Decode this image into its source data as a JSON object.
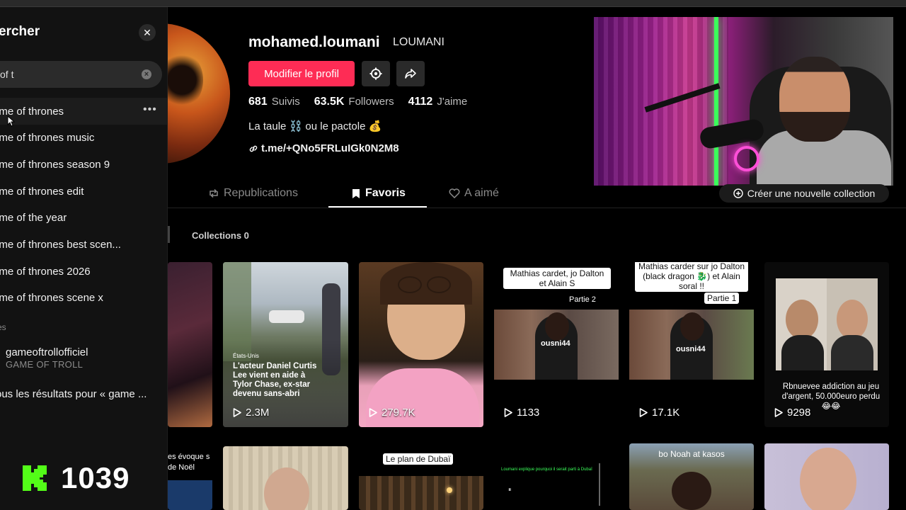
{
  "search": {
    "title": "ercher",
    "query": "of t",
    "suggestions": [
      "ame of thrones",
      "ame of thrones music",
      "ame of thrones season 9",
      "ame of thrones edit",
      "ame of the year",
      "ame of thrones best scen...",
      "ame of thrones 2026",
      "ame of thrones scene x"
    ],
    "section_label": "es",
    "account": {
      "username": "gameoftrollofficiel",
      "display_name": "GAME OF TROLL"
    },
    "all_results": "ous les résultats pour « game ..."
  },
  "overlay": {
    "counter": "1039",
    "badge_color": "#53fc18"
  },
  "profile": {
    "username": "mohamed.loumani",
    "nickname": "LOUMANI",
    "edit_button": "Modifier le profil",
    "stats": [
      {
        "value": "681",
        "label": "Suivis"
      },
      {
        "value": "63.5K",
        "label": "Followers"
      },
      {
        "value": "4112",
        "label": "J'aime"
      }
    ],
    "bio": "La taule ⛓️ ou le pactole 💰",
    "link": "t.me/+QNo5FRLuIGk0N2M8",
    "accent_color": "#fe2c55"
  },
  "tabs": [
    {
      "label": "Republications",
      "icon": "repost-icon"
    },
    {
      "label": "Favoris",
      "icon": "bookmark-icon"
    },
    {
      "label": "A aimé",
      "icon": "heart-icon"
    }
  ],
  "new_collection_label": "Créer une nouvelle collection",
  "collections_label": "Collections 0",
  "videos_row1": [
    {
      "views": ""
    },
    {
      "views": "2.3M",
      "caption_tag": "États-Unis",
      "caption": "L'acteur Daniel Curtis Lee vient en aide à Tylor Chase, ex-star devenu sans-abri"
    },
    {
      "views": "279.7K"
    },
    {
      "views": "1133",
      "caption": "Mathias cardet, jo Dalton et Alain S",
      "sub": "Partie 2",
      "overlay": "ousni44"
    },
    {
      "views": "17.1K",
      "caption": "Mathias carder sur jo Dalton (black dragon 🐉) et Alain soral !!",
      "sub": "Partie 1",
      "overlay": "ousni44"
    },
    {
      "views": "9298",
      "caption": "Rbnuevee addiction au jeu d'argent, 50.000euro perdu 😂😂"
    }
  ],
  "videos_row2": [
    {
      "caption": "es évoque s de Noël"
    },
    {
      "caption": ""
    },
    {
      "caption": "Le plan de Dubaï"
    },
    {
      "caption": "Loumani explique pourquoi il serait parti à Dubaï"
    },
    {
      "caption": "bo Noah at kasos"
    },
    {
      "caption": ""
    }
  ]
}
